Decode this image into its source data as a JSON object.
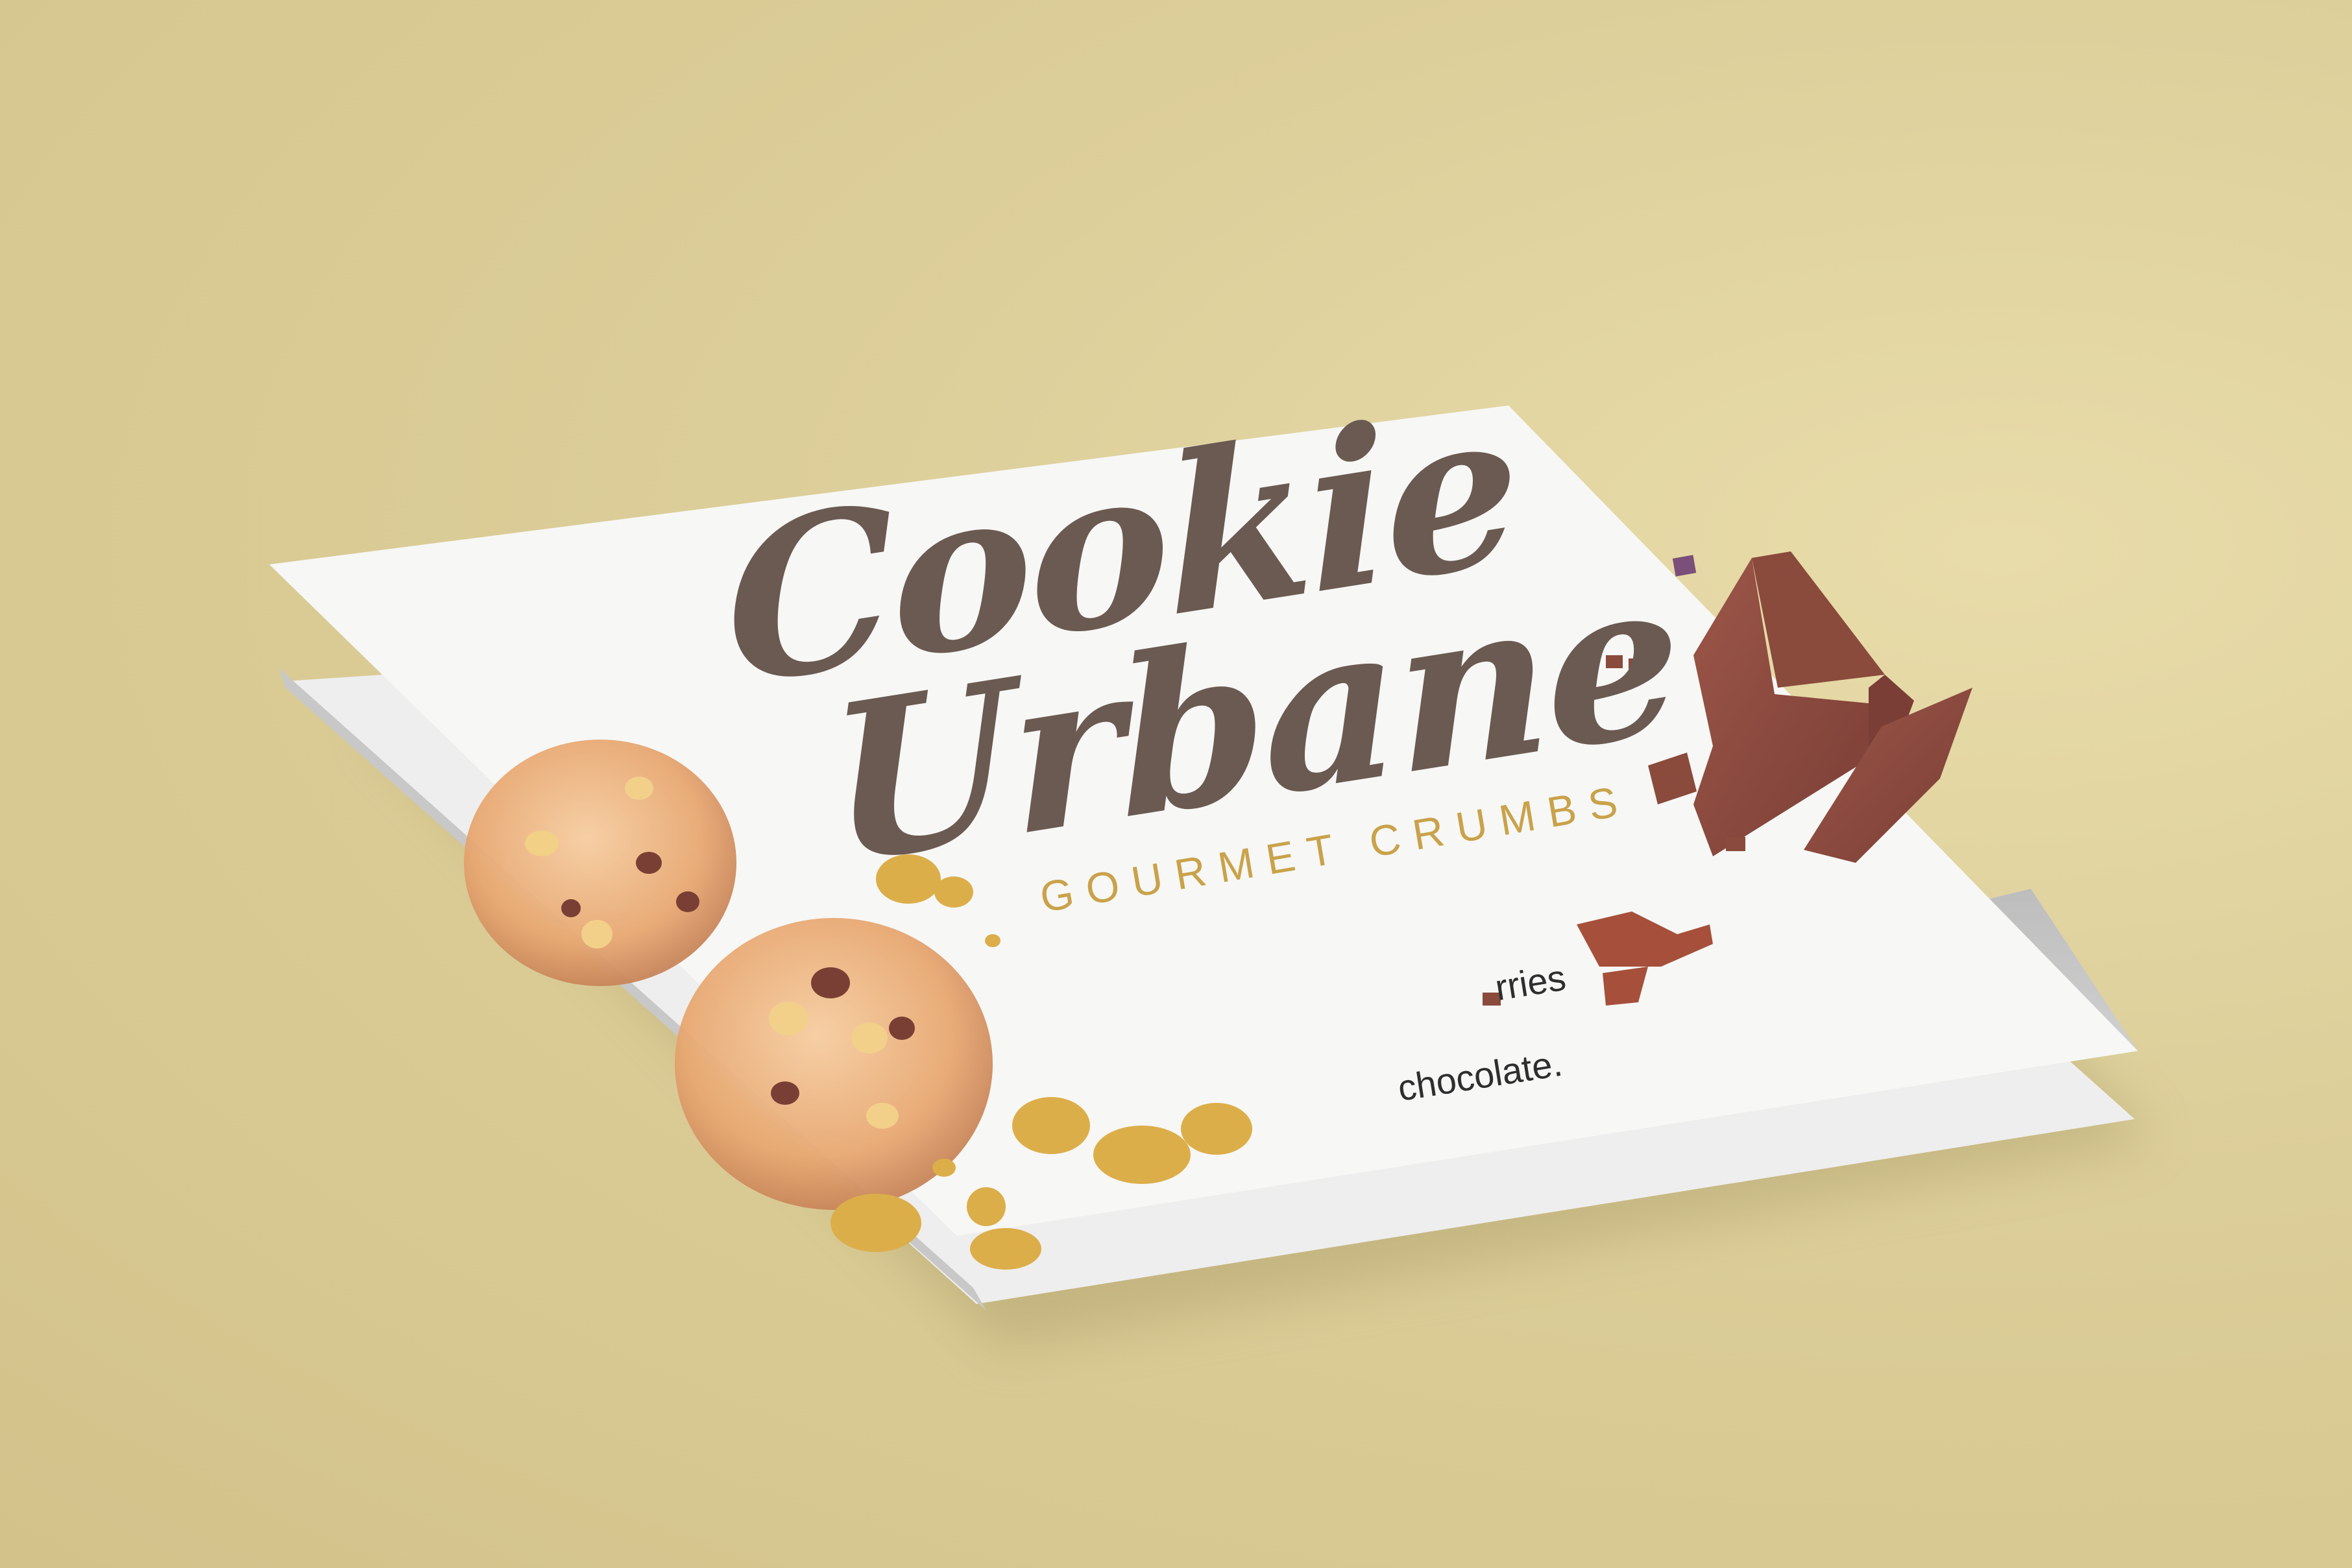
{
  "brochure": {
    "title_line_1": "Cookie",
    "title_line_2": "Urbane",
    "tagline": "GOURMET CRUMBS",
    "inside_fragment_1": "rries",
    "inside_fragment_2": "chocolate."
  },
  "colors": {
    "background": "#ddcf9a",
    "paper": "#f7f7f5",
    "logo_brown": "#6a5a52",
    "tagline_gold": "#c9a24a",
    "chocolate": "#8a4a3c",
    "cookie": "#e8b07a"
  }
}
